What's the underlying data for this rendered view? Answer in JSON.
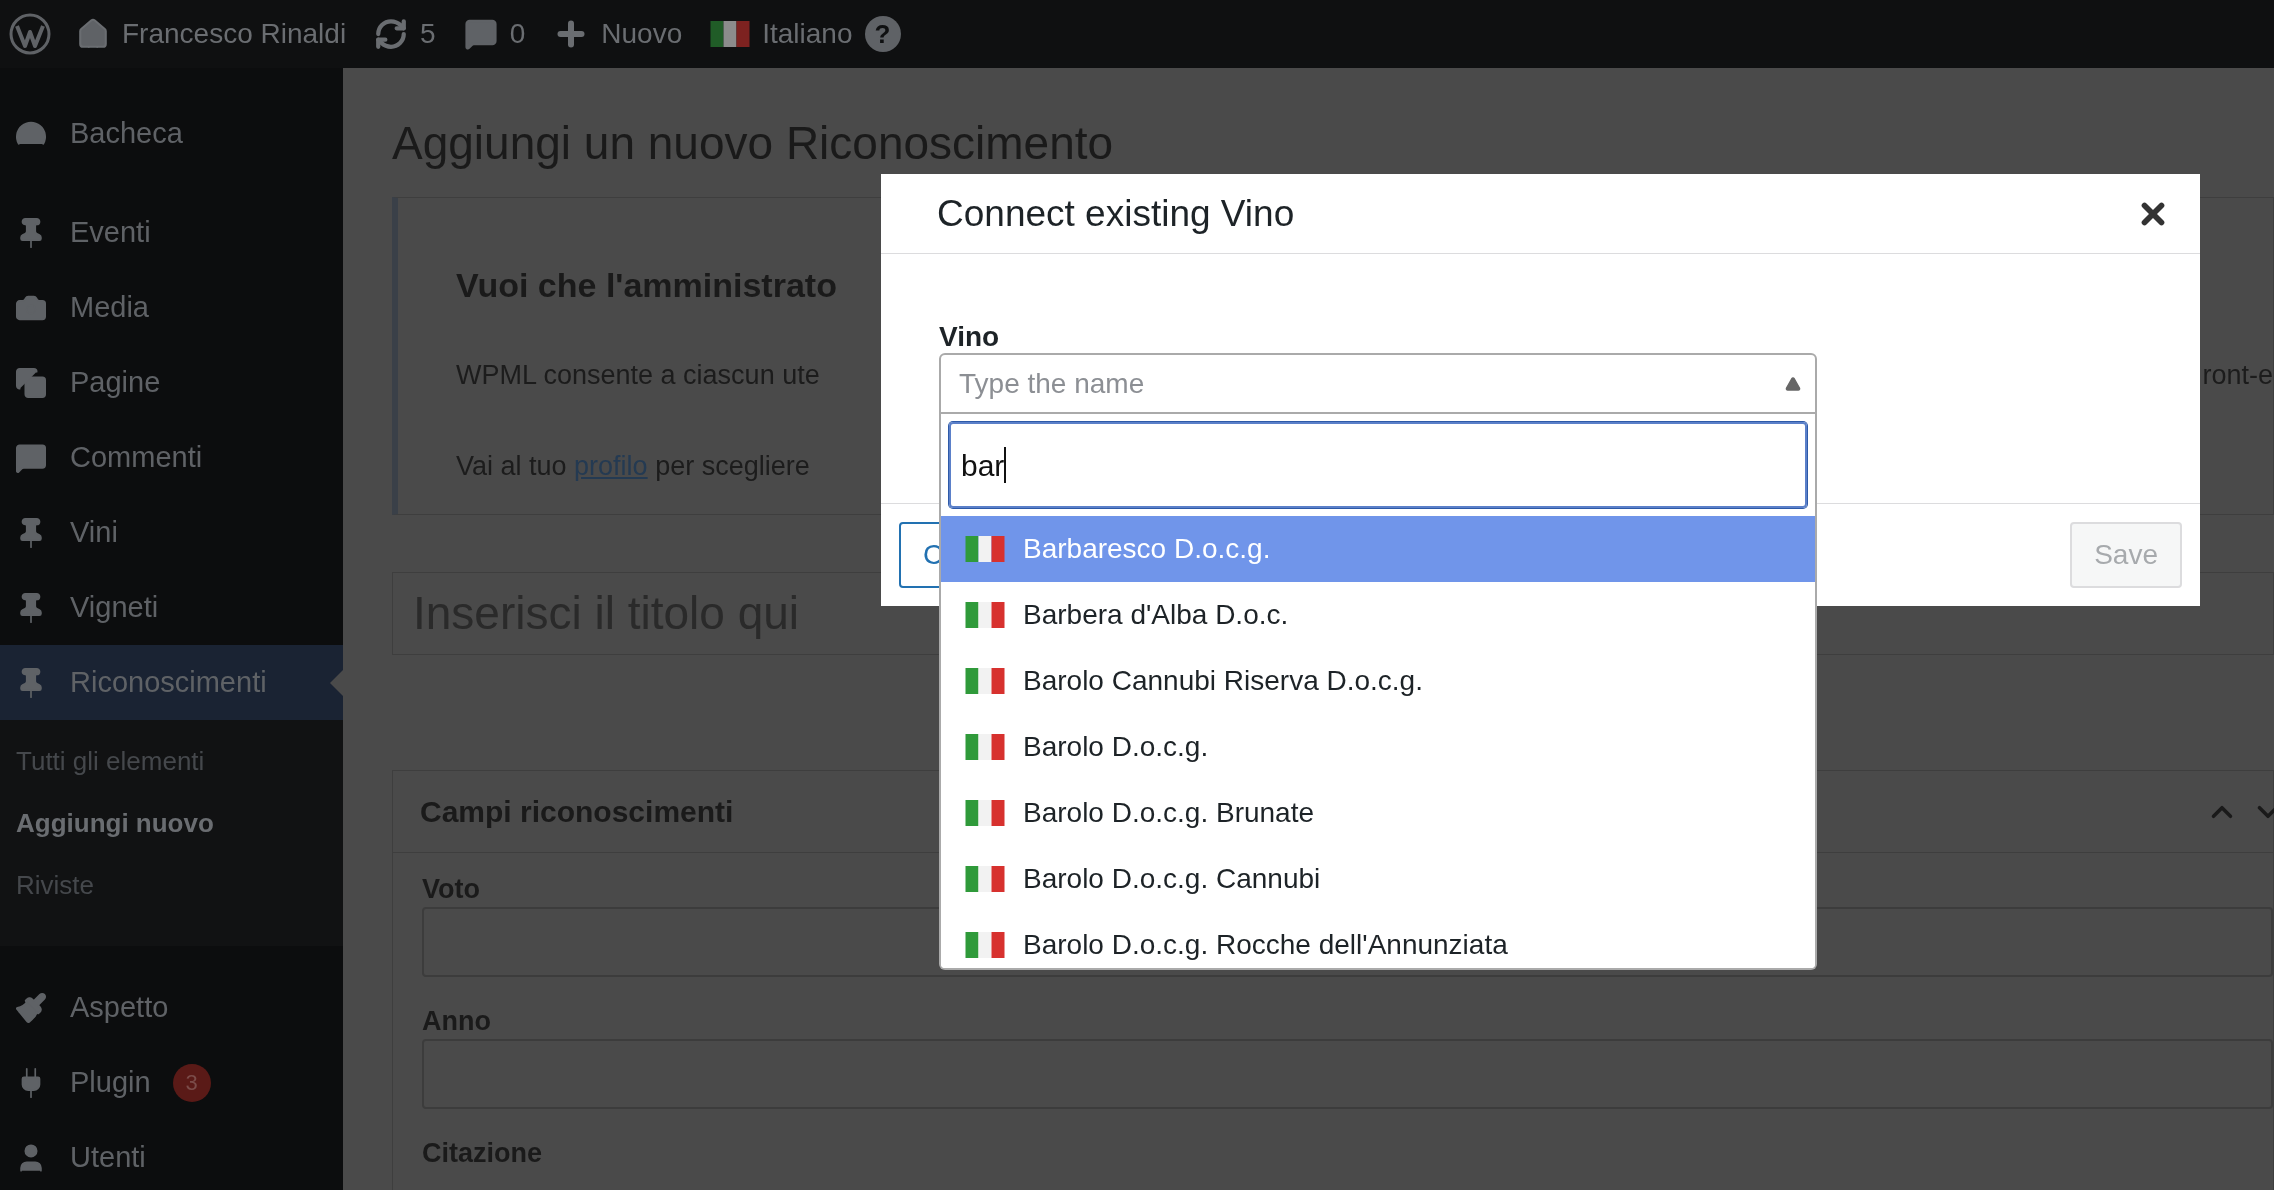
{
  "top_bar": {
    "items": [
      {
        "kind": "logo"
      },
      {
        "kind": "site",
        "label": "Francesco Rinaldi"
      },
      {
        "kind": "updates",
        "label": "5"
      },
      {
        "kind": "comments",
        "label": "0"
      },
      {
        "kind": "new",
        "label": "Nuovo"
      },
      {
        "kind": "language",
        "label": "Italiano"
      },
      {
        "kind": "help",
        "label": "?"
      }
    ]
  },
  "sidebar": {
    "items": [
      {
        "kind": "dashboard",
        "label": "Bacheca",
        "selected": false
      },
      {
        "kind": "pin",
        "label": "Eventi",
        "selected": false
      },
      {
        "kind": "media",
        "label": "Media",
        "selected": false
      },
      {
        "kind": "pages",
        "label": "Pagine",
        "selected": false
      },
      {
        "kind": "comments",
        "label": "Commenti",
        "selected": false
      },
      {
        "kind": "pin",
        "label": "Vini",
        "selected": false
      },
      {
        "kind": "pin",
        "label": "Vigneti",
        "selected": false
      },
      {
        "kind": "pin",
        "label": "Riconoscimenti",
        "selected": true,
        "children": [
          {
            "label": "Tutti gli elementi",
            "selected": false
          },
          {
            "label": "Aggiungi nuovo",
            "selected": true
          },
          {
            "label": "Riviste",
            "selected": false
          }
        ]
      },
      {
        "kind": "appearance",
        "label": "Aspetto",
        "selected": false
      },
      {
        "kind": "plugin",
        "label": "Plugin",
        "badge": "3",
        "selected": false
      },
      {
        "kind": "user",
        "label": "Utenti",
        "selected": false
      }
    ]
  },
  "main": {
    "title": "Aggiungi un nuovo Riconoscimento",
    "notice": {
      "heading": "Vuoi che l'amministrato",
      "text": "WPML consente a ciascun ute",
      "text_right": "ront-e",
      "link_before": "Vai al tuo ",
      "link": "profilo",
      "link_after": " per scegliere"
    },
    "title_field": {
      "placeholder": "Inserisci il titolo qui"
    },
    "panel": {
      "title": "Campi riconoscimenti",
      "fields": [
        {
          "label": "Voto",
          "kind": "input"
        },
        {
          "label": "Anno",
          "kind": "input"
        },
        {
          "label": "Citazione",
          "kind": "label"
        }
      ]
    }
  },
  "modal": {
    "title": "Connect existing Vino",
    "field_label": "Vino",
    "select": {
      "placeholder": "Type the name",
      "expanded": true
    },
    "search": {
      "value": "bar"
    },
    "options": [
      {
        "label": "Barbaresco D.o.c.g.",
        "selected": true
      },
      {
        "label": "Barbera d'Alba D.o.c.",
        "selected": false
      },
      {
        "label": "Barolo Cannubi Riserva D.o.c.g.",
        "selected": false
      },
      {
        "label": "Barolo D.o.c.g.",
        "selected": false
      },
      {
        "label": "Barolo D.o.c.g. Brunate",
        "selected": false
      },
      {
        "label": "Barolo D.o.c.g. Cannubi",
        "selected": false
      },
      {
        "label": "Barolo D.o.c.g. Rocche dell'Annunziata",
        "selected": false
      }
    ],
    "buttons": [
      {
        "label": "C",
        "kind": "primary",
        "disabled": false
      },
      {
        "label": "Save",
        "kind": "secondary",
        "disabled": true
      }
    ]
  }
}
